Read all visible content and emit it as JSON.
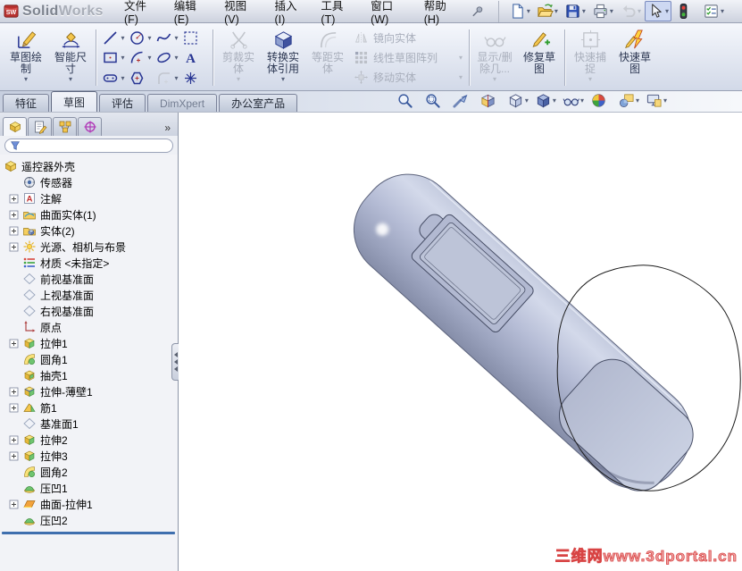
{
  "glyphs": {
    "caret": "▾",
    "chevron": "»"
  },
  "colors": {
    "watermark": "#e04848",
    "rollback": "#3f6fae",
    "icon_navy": "#283593",
    "model_body": "#b6bdd6",
    "disabled_text": "#a9afbc"
  },
  "window": {
    "logo_strong": "Solid",
    "logo_light": "Works"
  },
  "menubar": {
    "items": [
      {
        "label": "文件(F)"
      },
      {
        "label": "编辑(E)"
      },
      {
        "label": "视图(V)"
      },
      {
        "label": "插入(I)"
      },
      {
        "label": "工具(T)"
      },
      {
        "label": "窗口(W)"
      },
      {
        "label": "帮助(H)"
      }
    ]
  },
  "quickbar": {
    "items": [
      {
        "icon": "new-file",
        "name": "new-document",
        "caret": true
      },
      {
        "icon": "open-folder",
        "name": "open-document",
        "caret": true
      },
      {
        "icon": "save",
        "name": "save-document",
        "caret": true
      },
      {
        "icon": "print",
        "name": "print-document",
        "caret": true
      },
      {
        "icon": "undo",
        "name": "undo",
        "caret": true,
        "disabled": true
      },
      {
        "icon": "select-cursor",
        "name": "select-tool",
        "caret": true,
        "pressed": true
      },
      {
        "icon": "rebuild-light",
        "name": "rebuild"
      },
      {
        "icon": "options-list",
        "name": "options",
        "caret": true
      },
      {
        "icon": "partial-icon",
        "name": "clipped-toolbar-icon",
        "partial": true
      }
    ]
  },
  "command_manager": {
    "group1": [
      {
        "label": "草图绘\n制",
        "icon": "sketch-pencil",
        "caret": true
      },
      {
        "label": "智能尺\n寸",
        "icon": "smart-dimension",
        "caret": true
      }
    ],
    "grid_rows": {
      "row1": [
        {
          "icon": "line",
          "caret": true
        },
        {
          "icon": "circle",
          "caret": true
        },
        {
          "icon": "spline",
          "caret": true
        },
        {
          "icon": "select-box"
        }
      ],
      "row2": [
        {
          "icon": "rectangle",
          "caret": true
        },
        {
          "icon": "arc",
          "caret": true
        },
        {
          "icon": "ellipse",
          "caret": true
        },
        {
          "icon": "text"
        }
      ],
      "row3": [
        {
          "icon": "slot",
          "caret": true
        },
        {
          "icon": "polygon"
        },
        {
          "icon": "sketch-fillet",
          "caret": true,
          "disabled": true
        },
        {
          "icon": "point"
        }
      ]
    },
    "group2": [
      {
        "label": "剪裁实\n体",
        "icon": "trim",
        "caret": true,
        "disabled": true
      },
      {
        "label": "转换实\n体引用",
        "icon": "convert",
        "caret": true
      },
      {
        "label": "等距实\n体",
        "icon": "offset",
        "disabled": true
      }
    ],
    "stacked": [
      {
        "label": "镜向实体",
        "icon": "mirror",
        "disabled": true
      },
      {
        "label": "线性草图阵列",
        "icon": "linear-pattern",
        "caret": true,
        "disabled": true
      },
      {
        "label": "移动实体",
        "icon": "move",
        "caret": true,
        "disabled": true
      }
    ],
    "group3": [
      {
        "label": "显示/删\n除几...",
        "icon": "display-delete",
        "caret": true,
        "disabled": true
      },
      {
        "label": "修复草\n图",
        "icon": "repair"
      }
    ],
    "group4": [
      {
        "label": "快速捕\n捉",
        "icon": "quick-snap",
        "caret": true,
        "disabled": true
      },
      {
        "label": "快速草\n图",
        "icon": "rapid-sketch"
      }
    ]
  },
  "tabs": {
    "items": [
      {
        "label": "特征"
      },
      {
        "label": "草图",
        "active": true
      },
      {
        "label": "评估"
      },
      {
        "label": "DimXpert",
        "muted": true
      },
      {
        "label": "办公室产品"
      }
    ]
  },
  "viewbar": {
    "items": [
      {
        "icon": "zoom-fit",
        "name": "zoom-to-fit"
      },
      {
        "icon": "zoom-area",
        "name": "zoom-to-area"
      },
      {
        "icon": "prev-view",
        "name": "previous-view"
      },
      {
        "icon": "section",
        "name": "section-view"
      },
      {
        "icon": "view-orient",
        "name": "view-orientation",
        "caret": true
      },
      {
        "icon": "display-style",
        "name": "display-style",
        "caret": true
      },
      {
        "icon": "hide-show",
        "name": "hide-show-items",
        "caret": true
      },
      {
        "icon": "appearance",
        "name": "edit-appearance"
      },
      {
        "icon": "scene",
        "name": "apply-scene",
        "caret": true
      },
      {
        "icon": "view-settings",
        "name": "view-settings",
        "caret": true
      }
    ]
  },
  "panel": {
    "tabs": [
      {
        "icon": "tab-feature",
        "name": "featuremanager-tree-tab",
        "active": true
      },
      {
        "icon": "tab-property",
        "name": "propertymanager-tab"
      },
      {
        "icon": "tab-config",
        "name": "configurationmanager-tab"
      },
      {
        "icon": "tab-dimxpert",
        "name": "dimxpertmanager-tab"
      }
    ],
    "filter_placeholder": ""
  },
  "feature_tree": {
    "items": [
      {
        "label": "遥控器外壳",
        "icon": "part",
        "root": true
      },
      {
        "label": "传感器",
        "icon": "sensor"
      },
      {
        "label": "注解",
        "icon": "annotation",
        "plus": true
      },
      {
        "label": "曲面实体(1)",
        "icon": "surface-folder",
        "plus": true
      },
      {
        "label": "实体(2)",
        "icon": "solid-folder",
        "plus": true
      },
      {
        "label": "光源、相机与布景",
        "icon": "lights",
        "plus": true
      },
      {
        "label": "材质 <未指定>",
        "icon": "material"
      },
      {
        "label": "前视基准面",
        "icon": "plane"
      },
      {
        "label": "上视基准面",
        "icon": "plane"
      },
      {
        "label": "右视基准面",
        "icon": "plane"
      },
      {
        "label": "原点",
        "icon": "origin"
      },
      {
        "label": "拉伸1",
        "icon": "extrude",
        "plus": true
      },
      {
        "label": "圆角1",
        "icon": "fillet"
      },
      {
        "label": "抽壳1",
        "icon": "shell"
      },
      {
        "label": "拉伸-薄壁1",
        "icon": "thin-extrude",
        "plus": true
      },
      {
        "label": "筋1",
        "icon": "rib",
        "plus": true
      },
      {
        "label": "基准面1",
        "icon": "plane"
      },
      {
        "label": "拉伸2",
        "icon": "extrude",
        "plus": true
      },
      {
        "label": "拉伸3",
        "icon": "extrude",
        "plus": true
      },
      {
        "label": "圆角2",
        "icon": "fillet"
      },
      {
        "label": "压凹1",
        "icon": "indent"
      },
      {
        "label": "曲面-拉伸1",
        "icon": "surface-extrude",
        "plus": true
      },
      {
        "label": "压凹2",
        "icon": "indent"
      }
    ]
  },
  "viewport": {
    "watermark": "三维网www.3dportal.cn"
  }
}
